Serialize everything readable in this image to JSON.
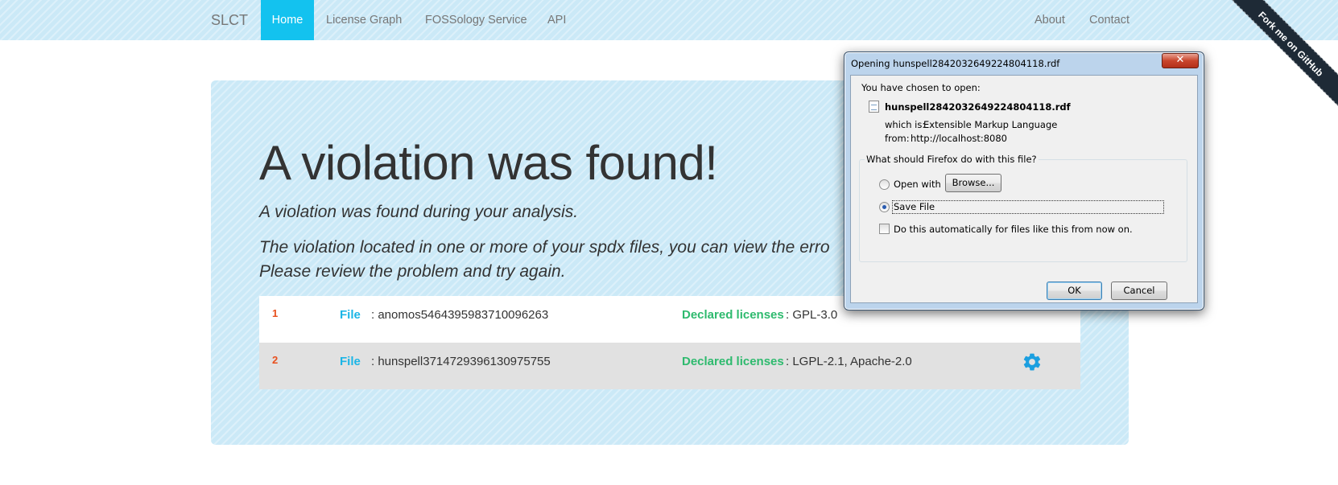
{
  "navbar": {
    "brand": "SLCT",
    "left_items": [
      {
        "label": "Home",
        "active": true
      },
      {
        "label": "License Graph"
      },
      {
        "label": "FOSSology Service"
      },
      {
        "label": "API"
      }
    ],
    "right_items": [
      {
        "label": "About"
      },
      {
        "label": "Contact"
      }
    ]
  },
  "ribbon": {
    "label": "Fork me on GitHub"
  },
  "main": {
    "title": "A violation was found!",
    "subtitle": "A violation was found during your analysis.",
    "message_line1": "The violation located in one or more of your spdx files, you can view the erro",
    "message_line2": "Please review the problem and try again."
  },
  "results": [
    {
      "index": "1",
      "file_label": "File",
      "file_name": "anomos5464395983710096263",
      "licenses_label": "Declared licenses",
      "licenses": "GPL-3.0"
    },
    {
      "index": "2",
      "file_label": "File",
      "file_name": "hunspell3714729396130975755",
      "licenses_label": "Declared licenses",
      "licenses": "LGPL-2.1, Apache-2.0"
    }
  ],
  "dialog": {
    "title": "Opening hunspell2842032649224804118.rdf",
    "chosen_label": "You have chosen to open:",
    "file_name": "hunspell2842032649224804118.rdf",
    "which_is_label": "which is:",
    "which_is_value": "Extensible Markup Language",
    "from_label": "from:",
    "from_value": "http://localhost:8080",
    "question": "What should Firefox do with this file?",
    "open_with_label": "Open with",
    "browse_label": "Browse...",
    "save_file_label": "Save File",
    "auto_label": "Do this automatically for files like this from now on.",
    "selected_option": "Save File",
    "auto_checked": false,
    "ok_label": "OK",
    "cancel_label": "Cancel"
  },
  "colors": {
    "nav_active": "#13c2ef",
    "file_label": "#1bb5e6",
    "licenses_label": "#2eba6e",
    "index": "#e8501e",
    "gear": "#1b9fe0"
  }
}
